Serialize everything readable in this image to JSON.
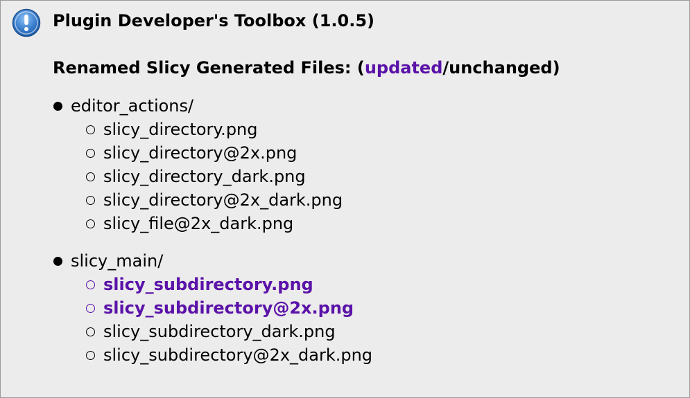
{
  "dialog": {
    "title": "Plugin Developer's Toolbox (1.0.5)",
    "icon": "info-icon"
  },
  "heading": {
    "prefix": "Renamed Slicy Generated Files: (",
    "updated_word": "updated",
    "separator": "/",
    "unchanged_word": "unchanged",
    "suffix": ")"
  },
  "colors": {
    "updated": "#5a12a8",
    "background": "#ececec",
    "icon_blue": "#3b7fcf"
  },
  "groups": [
    {
      "folder": "editor_actions/",
      "files": [
        {
          "name": "slicy_directory.png",
          "status": "unchanged"
        },
        {
          "name": "slicy_directory@2x.png",
          "status": "unchanged"
        },
        {
          "name": "slicy_directory_dark.png",
          "status": "unchanged"
        },
        {
          "name": "slicy_directory@2x_dark.png",
          "status": "unchanged"
        },
        {
          "name": "slicy_file@2x_dark.png",
          "status": "unchanged"
        }
      ]
    },
    {
      "folder": "slicy_main/",
      "files": [
        {
          "name": "slicy_subdirectory.png",
          "status": "updated"
        },
        {
          "name": "slicy_subdirectory@2x.png",
          "status": "updated"
        },
        {
          "name": "slicy_subdirectory_dark.png",
          "status": "unchanged"
        },
        {
          "name": "slicy_subdirectory@2x_dark.png",
          "status": "unchanged"
        }
      ]
    }
  ]
}
